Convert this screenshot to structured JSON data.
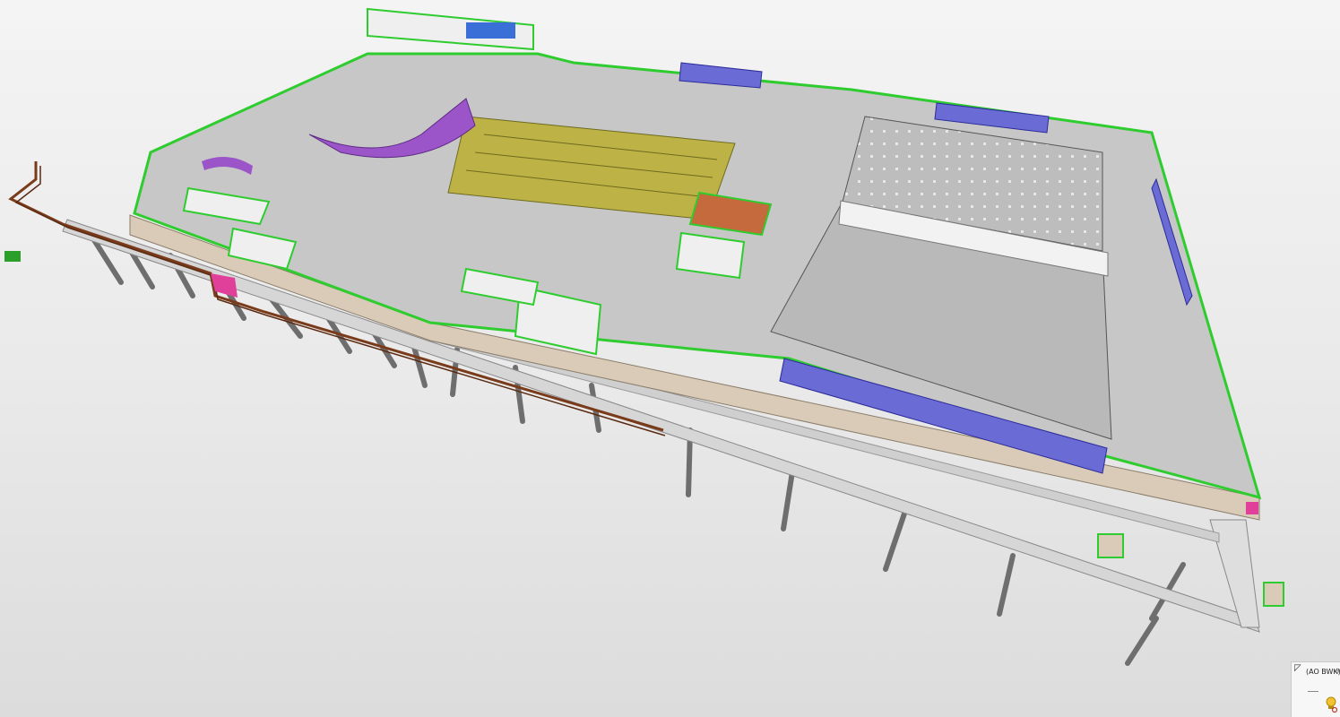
{
  "viewport": {
    "background_colors": [
      "#f4f4f4",
      "#dcdcdc"
    ],
    "model": {
      "slab_top_color": "#c7c7c7",
      "slab_edge_color": "#d9cbb8",
      "wall_outline_color": "#2ecc2e",
      "glazing_color": "#6b6bd6",
      "storage_rack_color": "#bdb245",
      "column_color": "#6e6e6e",
      "pipe_color": "#7a3b1a",
      "auditorium_color": "#9b55c8",
      "accent_pink": "#e0409a",
      "accent_orange": "#c46a3c"
    }
  },
  "view_indicator": {
    "label": "(AO BWK)",
    "corner_icon": "corner-arrow-icon",
    "link_icon": "link-icon",
    "sun_icon": "sun-path-icon"
  }
}
